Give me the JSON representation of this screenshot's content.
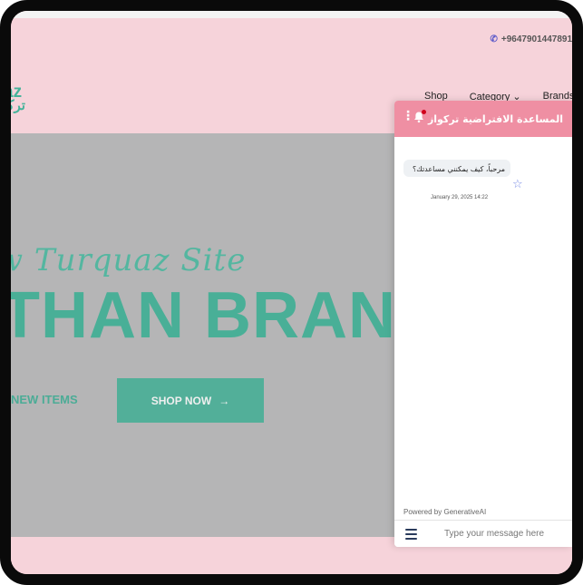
{
  "header": {
    "phone": "+9647901447891",
    "logo_latin": "az",
    "logo_arabic": "تركـ",
    "nav": [
      "Shop",
      "Category ⌄",
      "Brands"
    ]
  },
  "hero": {
    "script_line": "w Turquaz Site",
    "title_line": "THAN BRANI",
    "new_items_label": "NEW ITEMS",
    "shop_now_label": "SHOP NOW",
    "shop_now_arrow": "→"
  },
  "chat": {
    "title": "المساعدة الافتراضية تركواز",
    "message": "مرحباً، كيف يمكنني مساعدتك؟",
    "message_time": "January 29, 2025 14:22",
    "powered_by": "Powered by GenerativeAI",
    "input_placeholder": "Type your message here",
    "accent_color": "#ef8fa3"
  },
  "colors": {
    "brand_teal": "#45b39a",
    "page_pink": "#f6d3da",
    "hero_gray": "#bdbdbf"
  }
}
